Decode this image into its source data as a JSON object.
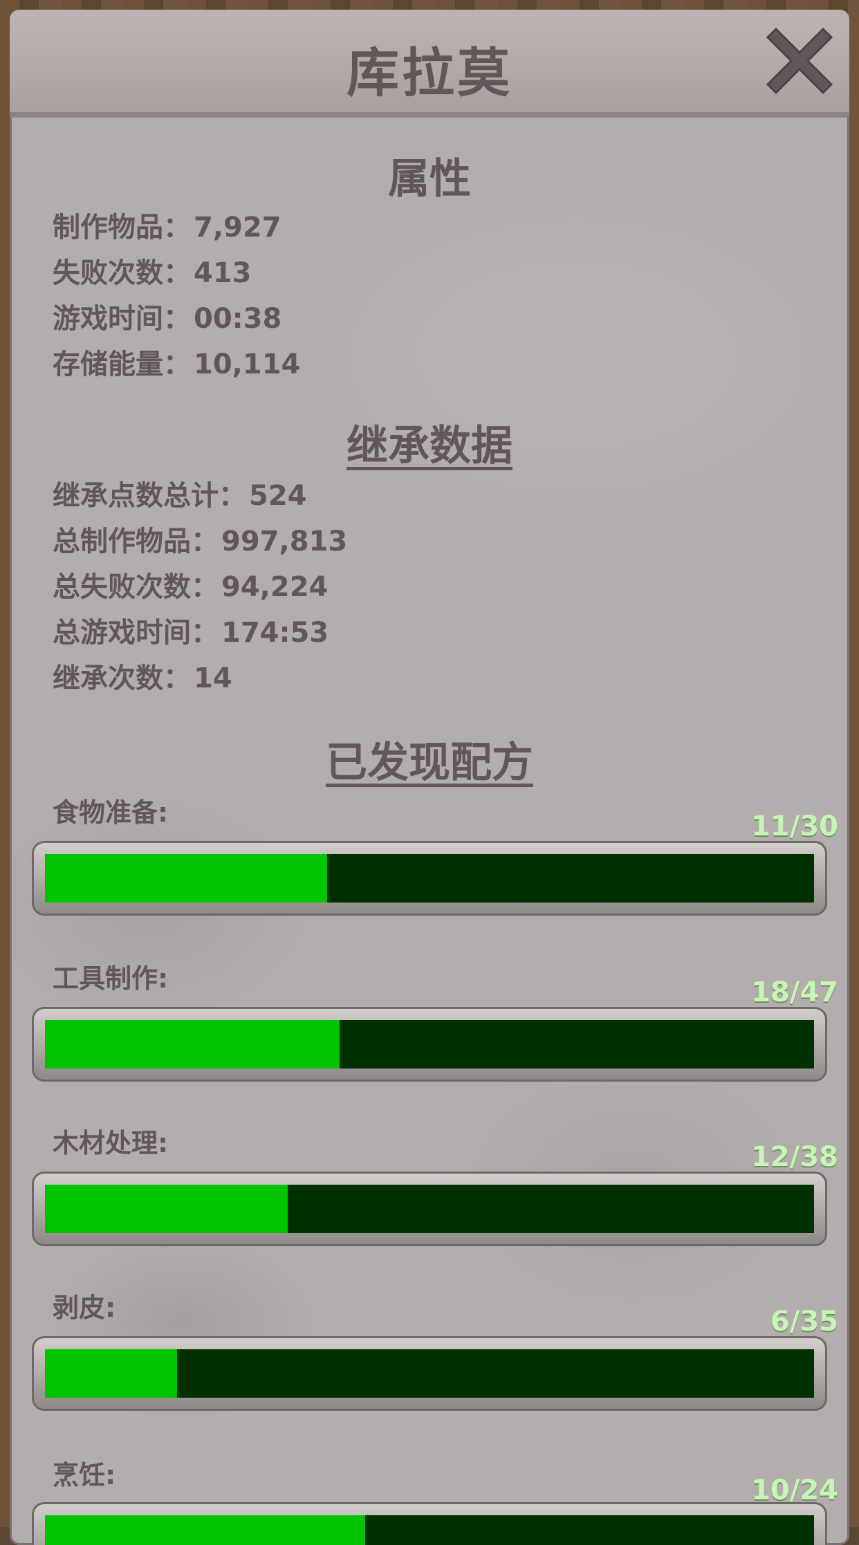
{
  "header": {
    "title": "库拉莫"
  },
  "attributes": {
    "heading": "属性",
    "items": [
      {
        "label": "制作物品：",
        "value": "7,927"
      },
      {
        "label": "失败次数：",
        "value": "413"
      },
      {
        "label": "游戏时间：",
        "value": "00:38"
      },
      {
        "label": "存储能量：",
        "value": "10,114"
      }
    ]
  },
  "inheritance": {
    "heading": "继承数据",
    "items": [
      {
        "label": "继承点数总计：",
        "value": "524"
      },
      {
        "label": "总制作物品：",
        "value": "997,813"
      },
      {
        "label": "总失败次数：",
        "value": "94,224"
      },
      {
        "label": "总游戏时间：",
        "value": "174:53"
      },
      {
        "label": "继承次数：",
        "value": "14"
      }
    ]
  },
  "recipes": {
    "heading": "已发现配方",
    "items": [
      {
        "label": "食物准备:",
        "count": "11/30",
        "found": 11,
        "total": 30
      },
      {
        "label": "工具制作:",
        "count": "18/47",
        "found": 18,
        "total": 47
      },
      {
        "label": "木材处理:",
        "count": "12/38",
        "found": 12,
        "total": 38
      },
      {
        "label": "剥皮:",
        "count": "6/35",
        "found": 6,
        "total": 35
      },
      {
        "label": "烹饪:",
        "count": "10/24",
        "found": 10,
        "total": 24
      }
    ]
  },
  "colors": {
    "bar_fill": "#00c400",
    "bar_track": "#002f00",
    "count_text": "#c6f5b4",
    "text": "#5f5758"
  },
  "icons": {
    "close": "close-x-icon"
  }
}
